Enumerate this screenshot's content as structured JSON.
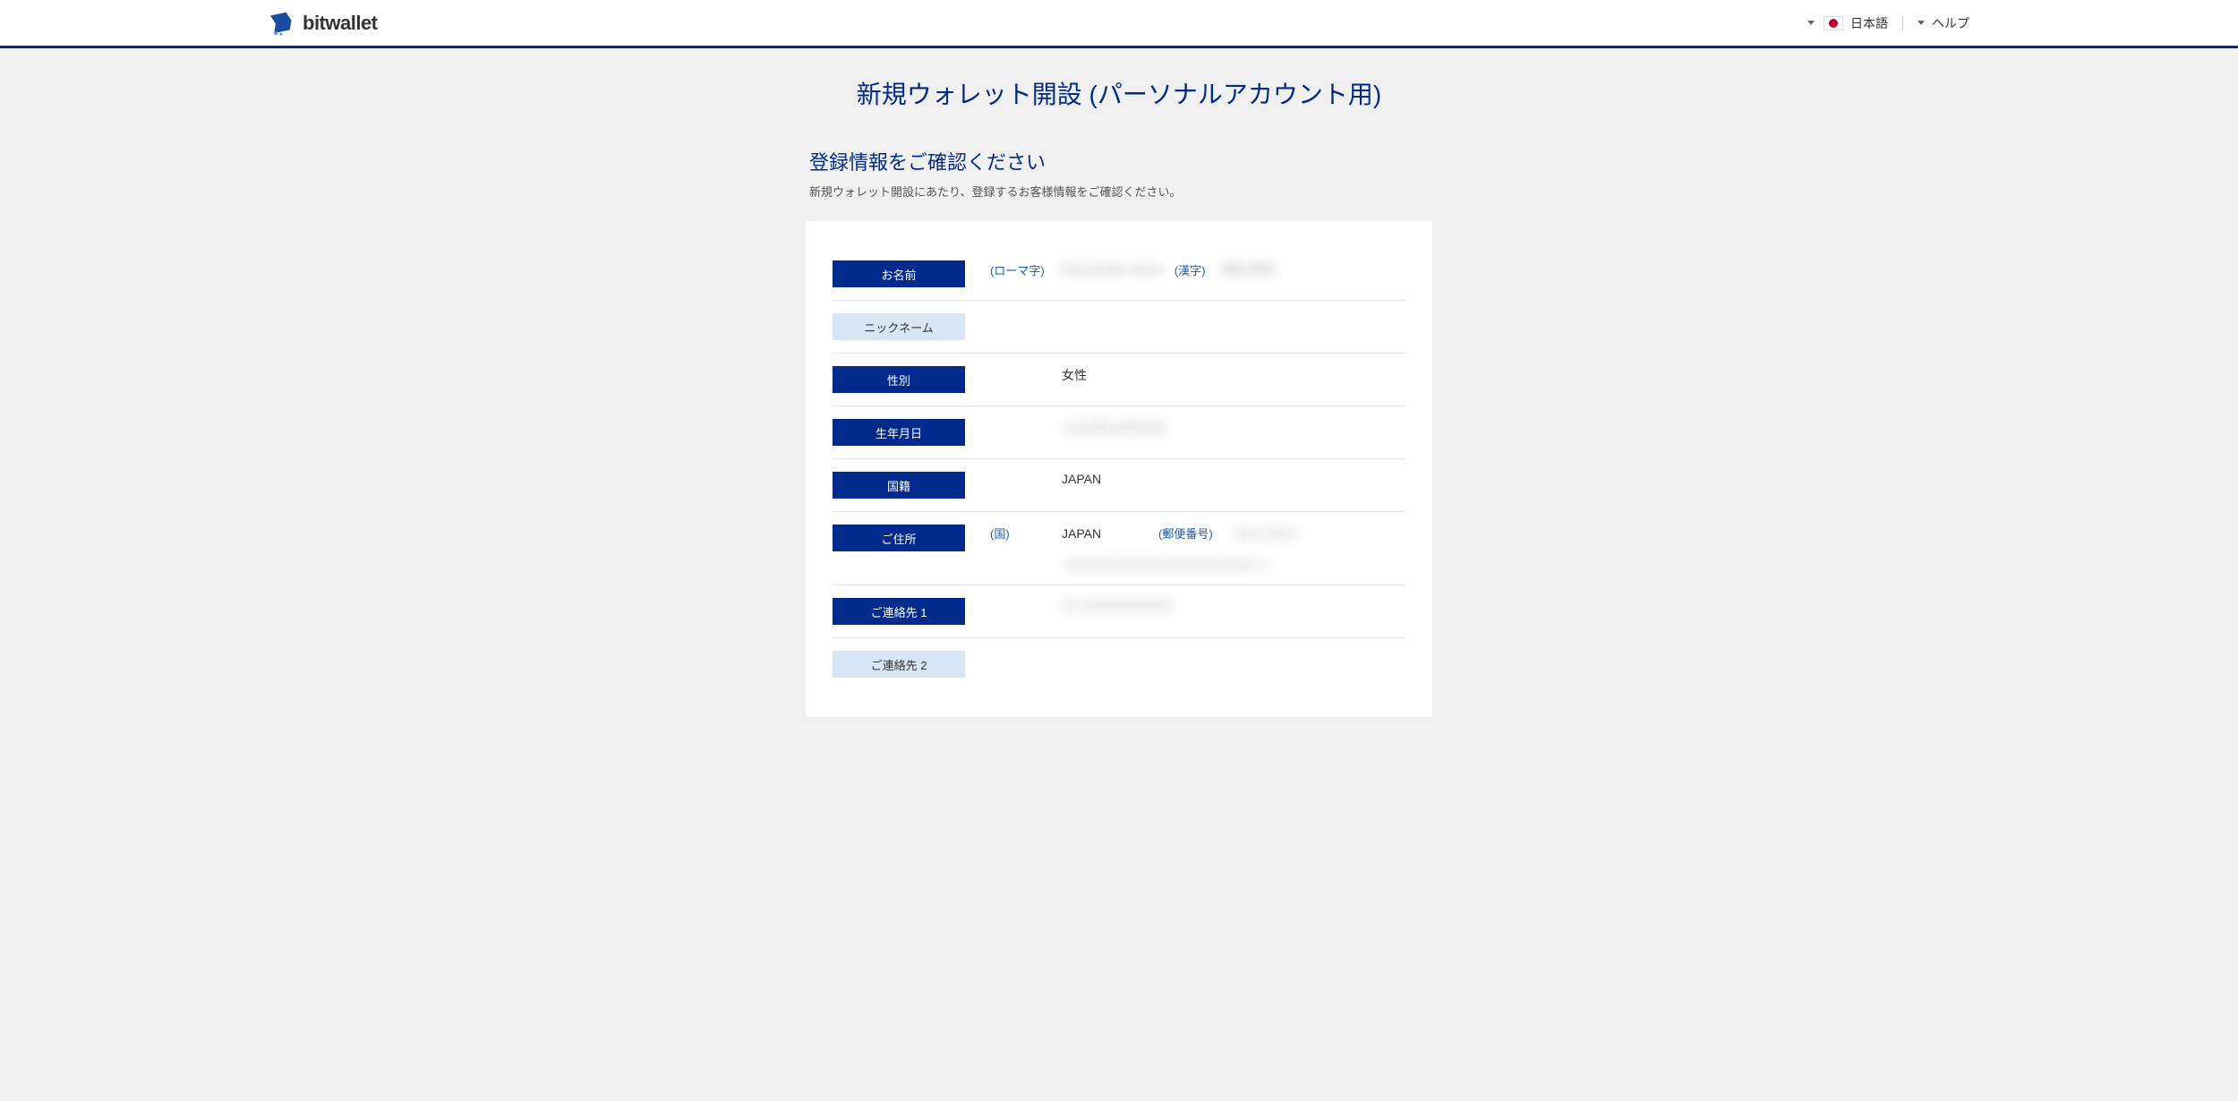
{
  "header": {
    "logo_text": "bitwallet",
    "language": "日本語",
    "help": "ヘルプ"
  },
  "page": {
    "title": "新規ウォレット開設 (パーソナルアカウント用)",
    "section_title": "登録情報をご確認ください",
    "section_subtitle": "新規ウォレット開設にあたり、登録するお客様情報をご確認ください。"
  },
  "labels": {
    "name": "お名前",
    "nickname": "ニックネーム",
    "gender": "性別",
    "birthdate": "生年月日",
    "nationality": "国籍",
    "address": "ご住所",
    "contact1": "ご連絡先 1",
    "contact2": "ご連絡先 2"
  },
  "sublabels": {
    "romaji": "(ローマ字)",
    "kanji": "(漢字)",
    "country": "(国)",
    "postal": "(郵便番号)"
  },
  "values": {
    "name_romaji_blur": "Placeholder Name",
    "name_kanji_blur": "例名 例名",
    "gender": "女性",
    "birthdate_blur": "XXXX年XX月XX日",
    "nationality": "JAPAN",
    "address_country": "JAPAN",
    "postal_blur": "XXX-XXXX",
    "address_line_blur": "XXXXXXXXXXXXXXXXXXXXXXX X",
    "contact1_blur": "XX XXXXXXXXXXX"
  }
}
